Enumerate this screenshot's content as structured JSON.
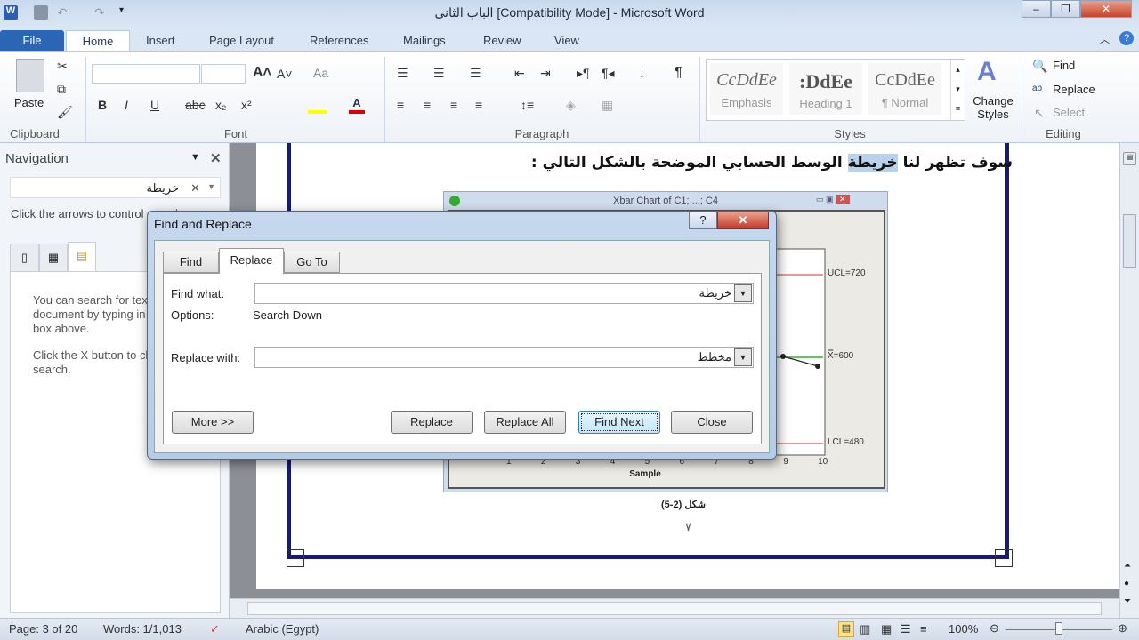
{
  "window": {
    "title": "الباب الثانى [Compatibility Mode]  -  Microsoft Word",
    "minimize": "–",
    "restore": "❐",
    "close": "✕"
  },
  "menu_tabs": [
    "File",
    "Home",
    "Insert",
    "Page Layout",
    "References",
    "Mailings",
    "Review",
    "View"
  ],
  "ribbon": {
    "clipboard": {
      "label": "Clipboard",
      "paste": "Paste"
    },
    "font": {
      "label": "Font",
      "font_name": "",
      "font_size": "",
      "bold": "B",
      "italic": "I",
      "underline": "U",
      "strike": "abc",
      "sub": "x₂",
      "sup": "x²",
      "grow": "A˄",
      "shrink": "A˅",
      "case": "Aa"
    },
    "paragraph": {
      "label": "Paragraph",
      "show_marks": "¶"
    },
    "styles": {
      "label": "Styles",
      "items": [
        {
          "sample": "CcDdEe",
          "name": "Emphasis"
        },
        {
          "sample": ":DdEe",
          "name": "Heading 1"
        },
        {
          "sample": "CcDdEe",
          "name": "¶ Normal"
        }
      ],
      "change_styles": "Change Styles"
    },
    "editing": {
      "label": "Editing",
      "find": "Find",
      "replace": "Replace",
      "select": "Select"
    }
  },
  "navigation": {
    "title": "Navigation",
    "search_value": "خريطة",
    "hint": "Click the arrows to control search",
    "info1": "You can search for text in your document by typing in the search box above.",
    "info2": "Click the X button to clear your search."
  },
  "document": {
    "line": "سوف تظهر لنا ",
    "highlight": "خريطة",
    "line_rest": " الوسط الحسابي الموضحة بالشكل التالي :",
    "figure_caption": "شكل (2-5)",
    "page_number": "٧"
  },
  "chart_window": {
    "title": "Xbar Chart of C1; ...; C4",
    "ucl": "UCL=720",
    "center": "X̿=600",
    "lcl": "LCL=480",
    "xlabel": "Sample",
    "ticks": [
      "1",
      "2",
      "3",
      "4",
      "5",
      "6",
      "7",
      "8",
      "9",
      "10"
    ],
    "colors": {
      "limits": "#e03030",
      "center": "#30b030",
      "series": "#222222"
    }
  },
  "dialog": {
    "title": "Find and Replace",
    "help": "?",
    "close": "✕",
    "tabs": [
      "Find",
      "Replace",
      "Go To"
    ],
    "active_tab": "Replace",
    "find_label": "Find what:",
    "find_value": "خريطة",
    "options_label": "Options:",
    "options_value": "Search Down",
    "replace_label": "Replace with:",
    "replace_value": "مخطط",
    "more": "More >>",
    "replace": "Replace",
    "replace_all": "Replace All",
    "find_next": "Find Next",
    "close_btn": "Close"
  },
  "status": {
    "page": "Page: 3 of 20",
    "words": "Words: 1/1,013",
    "language": "Arabic (Egypt)",
    "zoom": "100%",
    "zoom_percent": 100
  }
}
